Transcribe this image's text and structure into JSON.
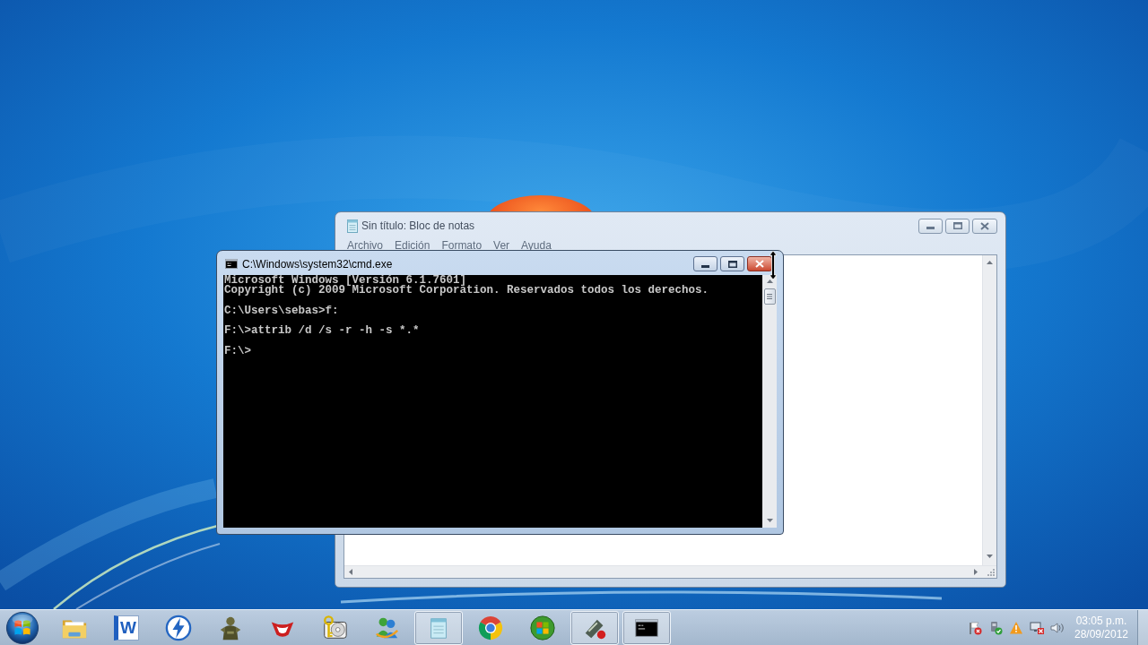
{
  "notepad": {
    "title": "Sin título: Bloc de notas",
    "active": false,
    "menu": [
      "Archivo",
      "Edición",
      "Formato",
      "Ver",
      "Ayuda"
    ]
  },
  "console": {
    "title": "C:\\Windows\\system32\\cmd.exe",
    "active": true,
    "close_hovered": true,
    "blocks": [
      [
        "Microsoft Windows [Versión 6.1.7601]",
        "Copyright (c) 2009 Microsoft Corporation. Reservados todos los derechos."
      ],
      [
        "C:\\Users\\sebas>f:"
      ],
      [
        "F:\\>attrib /d /s -r -h -s *.*"
      ],
      [
        "F:\\>"
      ]
    ]
  },
  "taskbar": {
    "items": [
      {
        "kind": "folder",
        "running": false
      },
      {
        "kind": "letter",
        "label": "W",
        "running": false
      },
      {
        "kind": "bolt",
        "running": false
      },
      {
        "kind": "figure",
        "running": false
      },
      {
        "kind": "mask",
        "running": false
      },
      {
        "kind": "keydisc",
        "running": false
      },
      {
        "kind": "people",
        "running": false
      },
      {
        "kind": "notepad",
        "running": true
      },
      {
        "kind": "circle",
        "running": false
      },
      {
        "kind": "orb",
        "running": false
      },
      {
        "kind": "pointer",
        "running": true
      },
      {
        "kind": "terminal",
        "running": true
      }
    ],
    "tray": [
      {
        "kind": "flag"
      },
      {
        "kind": "device"
      },
      {
        "kind": "warning"
      },
      {
        "kind": "monitor"
      },
      {
        "kind": "speaker"
      }
    ],
    "clock": {
      "time": "03:05 p.m.",
      "date": "28/09/2012"
    }
  }
}
